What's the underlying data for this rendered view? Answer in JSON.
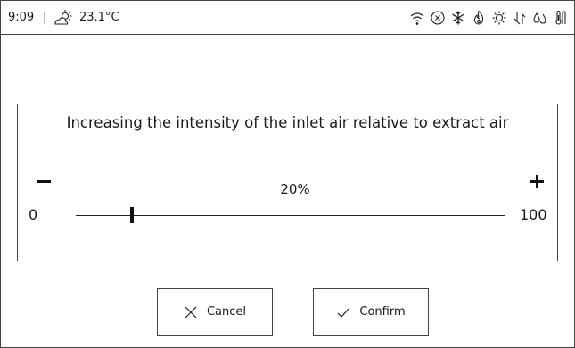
{
  "status": {
    "time": "9:09",
    "separator": "|",
    "weather_icon": "partly-sunny-icon",
    "temperature": "23.1°C",
    "icons": [
      "wifi-icon",
      "stop-circle-icon",
      "snowflake-icon",
      "flame-icon",
      "sun-gear-icon",
      "fan-down-icon",
      "humidity-icon",
      "thermometer-icon"
    ]
  },
  "dialog": {
    "title": "Increasing the intensity of the inlet air relative to extract air",
    "value": "20%",
    "min": "0",
    "max": "100",
    "level_percent": 13,
    "decrease_icon": "minus-icon",
    "increase_icon": "plus-icon"
  },
  "actions": {
    "cancel_label": "Cancel",
    "confirm_label": "Confirm"
  },
  "colors": {
    "foreground": "#1a1a1a",
    "border": "#444444",
    "background": "#ffffff"
  }
}
